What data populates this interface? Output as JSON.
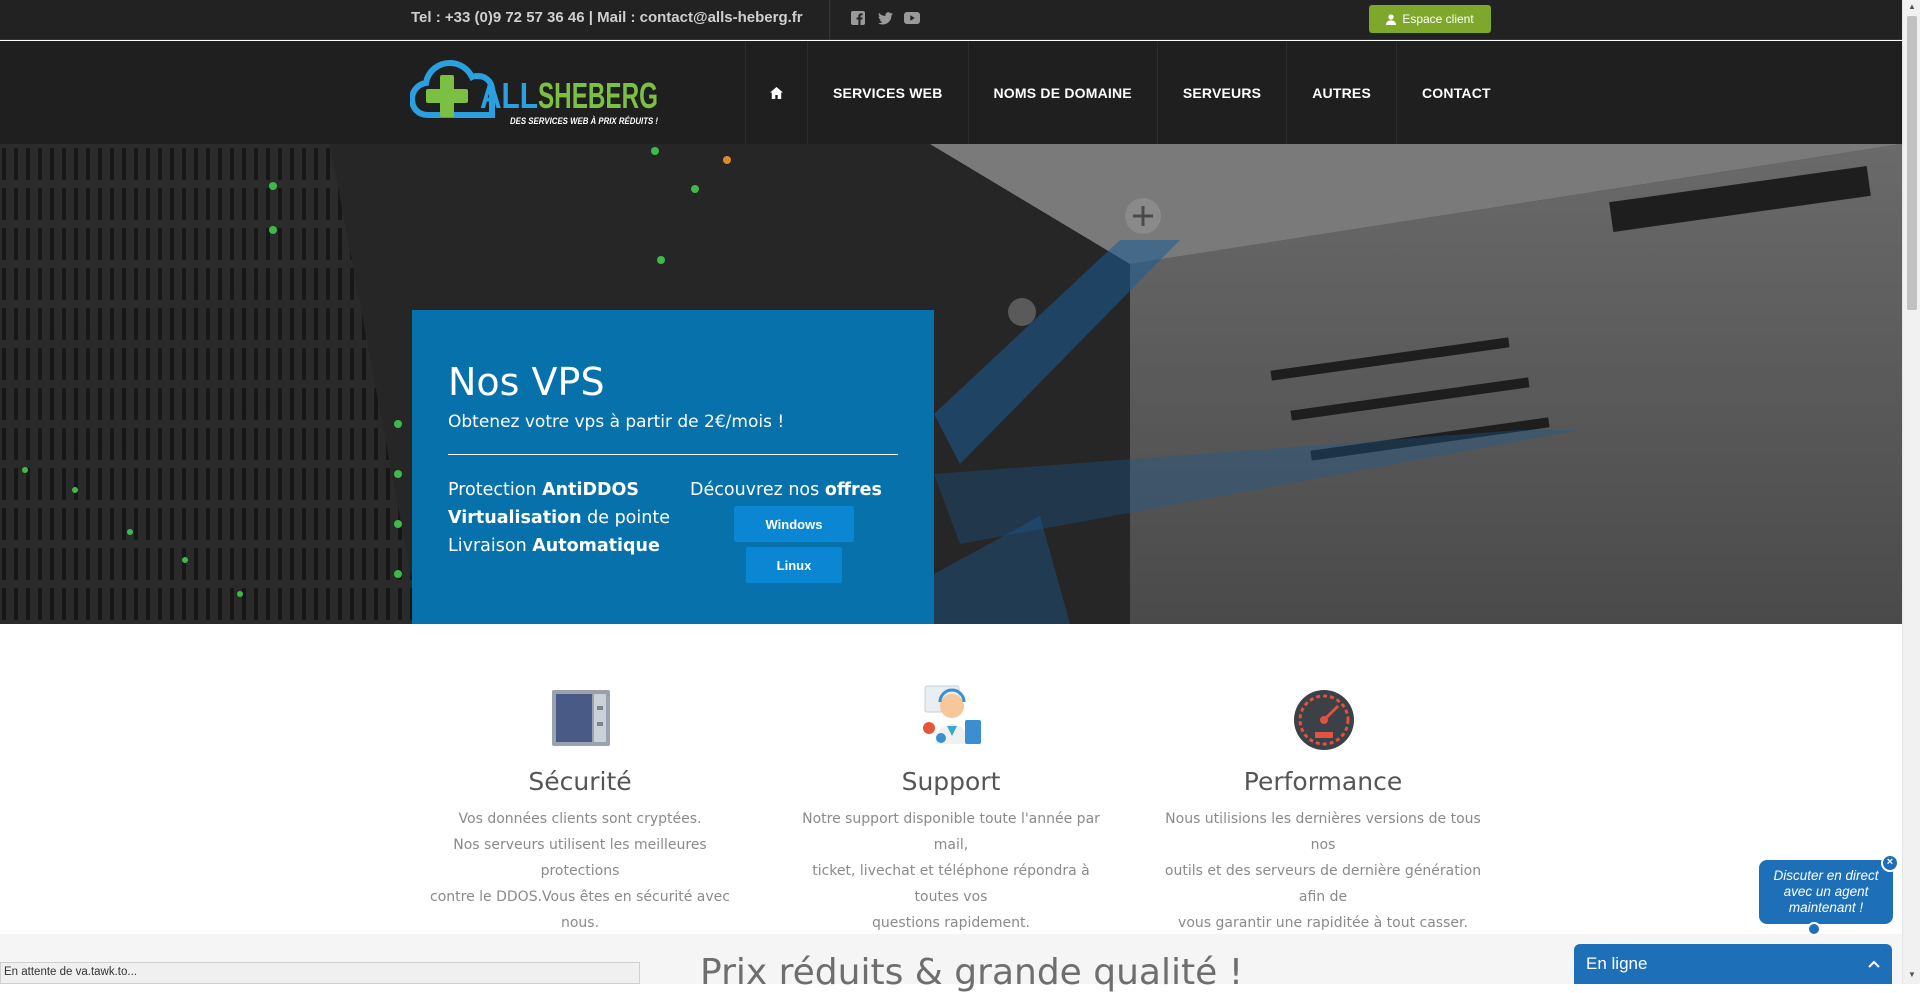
{
  "topbar": {
    "contact_text": "Tel : +33 (0)9 72 57 36 46 | Mail : contact@alls-heberg.fr",
    "social_icons": [
      "facebook-icon",
      "twitter-icon",
      "youtube-icon"
    ],
    "espace_client_label": "Espace client"
  },
  "brand": {
    "name": "ALLSHEBERG",
    "tagline": "DES SERVICES WEB À PRIX RÉDUITS !",
    "colors": {
      "blue": "#2aa0e0",
      "green": "#7cc043"
    }
  },
  "nav": {
    "home_icon": "home-icon",
    "items": [
      "SERVICES WEB",
      "NOMS DE DOMAINE",
      "SERVEURS",
      "AUTRES",
      "CONTACT"
    ]
  },
  "hero": {
    "title": "Nos VPS",
    "subtitle": "Obtenez votre vps à partir de 2€/mois !",
    "features": [
      {
        "prefix": "Protection ",
        "bold": "AntiDDOS",
        "suffix": ""
      },
      {
        "prefix": "",
        "bold": "Virtualisation",
        "suffix": " de pointe"
      },
      {
        "prefix": "Livraison ",
        "bold": "Automatique",
        "suffix": ""
      }
    ],
    "discover_prefix": "Découvrez nos ",
    "discover_bold": "offres",
    "buttons": [
      "Windows",
      "Linux"
    ],
    "accent_color": "#0082c8"
  },
  "features": [
    {
      "title": "Sécurité",
      "icon": "server-security-icon",
      "lines": [
        "Vos données clients sont cryptées.",
        "Nos serveurs utilisent les meilleures protections",
        "contre le DDOS.Vous êtes en sécurité avec nous."
      ]
    },
    {
      "title": "Support",
      "icon": "support-agent-icon",
      "lines": [
        "Notre support disponible toute l'année par mail,",
        "ticket, livechat et téléphone répondra à toutes vos",
        "questions rapidement."
      ]
    },
    {
      "title": "Performance",
      "icon": "speedometer-icon",
      "lines": [
        "Nous utilisions les dernières versions de tous nos",
        "outils et des serveurs de dernière génération afin de",
        "vous garantir une rapiditée à tout casser."
      ]
    }
  ],
  "section2": {
    "heading": "Prix réduits & grande qualité !"
  },
  "status_bar": {
    "text": "En attente de va.tawk.to..."
  },
  "chat": {
    "bubble_text": "Discuter en direct avec un agent maintenant !",
    "close_label": "×",
    "bar_label": "En ligne",
    "bar_icon": "chevron-up-icon"
  }
}
